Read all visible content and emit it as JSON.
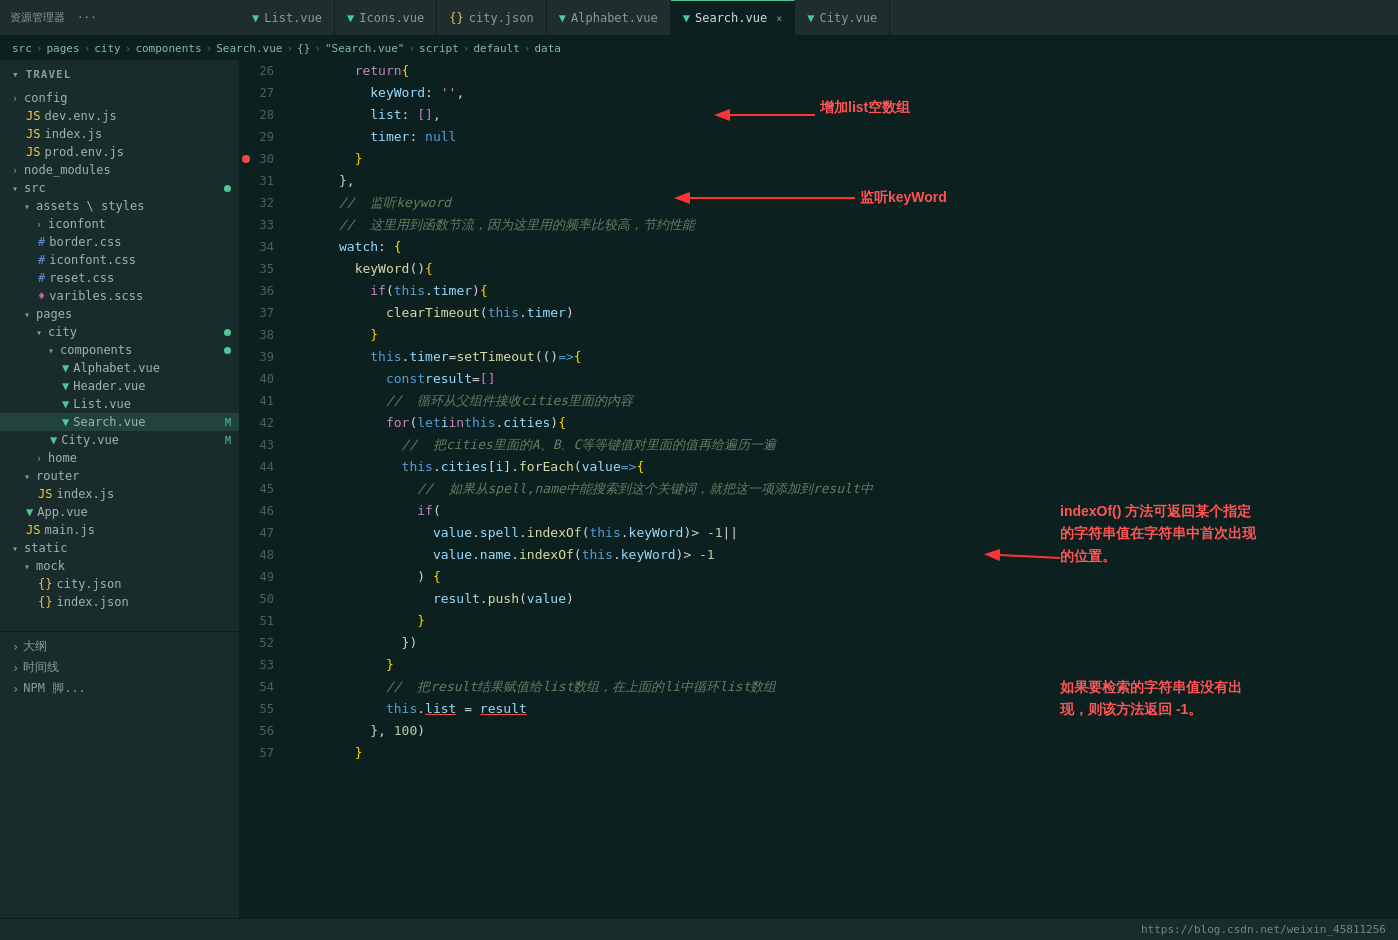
{
  "topbar": {
    "title": "资源管理器",
    "more_label": "···"
  },
  "tabs": [
    {
      "id": "list",
      "label": "List.vue",
      "type": "vue",
      "active": false,
      "modified": false
    },
    {
      "id": "icons",
      "label": "Icons.vue",
      "type": "vue",
      "active": false,
      "modified": false
    },
    {
      "id": "city-json",
      "label": "city.json",
      "type": "json",
      "active": false,
      "modified": false
    },
    {
      "id": "alphabet",
      "label": "Alphabet.vue",
      "type": "vue",
      "active": false,
      "modified": false
    },
    {
      "id": "search",
      "label": "Search.vue",
      "type": "vue",
      "active": true,
      "modified": false,
      "closable": true
    },
    {
      "id": "city-vue",
      "label": "City.vue",
      "type": "vue",
      "active": false,
      "modified": false
    }
  ],
  "breadcrumb": {
    "parts": [
      "src",
      "pages",
      "city",
      "components",
      "Search.vue",
      "{}",
      "\"Search.vue\"",
      "script",
      "default",
      "data"
    ]
  },
  "sidebar": {
    "root_label": "TRAVEL",
    "items": [
      {
        "id": "config",
        "label": "config",
        "type": "folder",
        "level": 1,
        "collapsed": true
      },
      {
        "id": "dev-env",
        "label": "dev.env.js",
        "type": "js",
        "level": 2
      },
      {
        "id": "index-js-config",
        "label": "index.js",
        "type": "js",
        "level": 2
      },
      {
        "id": "prod-env",
        "label": "prod.env.js",
        "type": "js",
        "level": 2
      },
      {
        "id": "node-modules",
        "label": "node_modules",
        "type": "folder",
        "level": 1,
        "collapsed": true
      },
      {
        "id": "src",
        "label": "src",
        "type": "folder",
        "level": 1,
        "expanded": true,
        "dot": true
      },
      {
        "id": "assets-styles",
        "label": "assets \\ styles",
        "type": "folder",
        "level": 2,
        "expanded": true
      },
      {
        "id": "iconfont",
        "label": "iconfont",
        "type": "folder",
        "level": 3,
        "collapsed": true
      },
      {
        "id": "border-css",
        "label": "border.css",
        "type": "css",
        "level": 3
      },
      {
        "id": "iconfont-css",
        "label": "iconfont.css",
        "type": "css",
        "level": 3
      },
      {
        "id": "reset-css",
        "label": "reset.css",
        "type": "css",
        "level": 3
      },
      {
        "id": "varibles-scss",
        "label": "varibles.scss",
        "type": "scss",
        "level": 3
      },
      {
        "id": "pages",
        "label": "pages",
        "type": "folder",
        "level": 2,
        "expanded": true
      },
      {
        "id": "city-folder",
        "label": "city",
        "type": "folder",
        "level": 3,
        "expanded": true,
        "dot": true
      },
      {
        "id": "components",
        "label": "components",
        "type": "folder",
        "level": 4,
        "expanded": true,
        "dot": true
      },
      {
        "id": "alphabet-vue",
        "label": "Alphabet.vue",
        "type": "vue",
        "level": 5
      },
      {
        "id": "header-vue",
        "label": "Header.vue",
        "type": "vue",
        "level": 5
      },
      {
        "id": "list-vue",
        "label": "List.vue",
        "type": "vue",
        "level": 5
      },
      {
        "id": "search-vue",
        "label": "Search.vue",
        "type": "vue",
        "level": 5,
        "badge": "M",
        "selected": true
      },
      {
        "id": "city-vue-file",
        "label": "City.vue",
        "type": "vue",
        "level": 4,
        "badge": "M"
      },
      {
        "id": "home",
        "label": "home",
        "type": "folder",
        "level": 3,
        "collapsed": true
      },
      {
        "id": "router",
        "label": "router",
        "type": "folder",
        "level": 2,
        "expanded": true
      },
      {
        "id": "router-index",
        "label": "index.js",
        "type": "js",
        "level": 3
      },
      {
        "id": "app-vue",
        "label": "App.vue",
        "type": "vue",
        "level": 2
      },
      {
        "id": "main-js",
        "label": "main.js",
        "type": "js",
        "level": 2
      },
      {
        "id": "static",
        "label": "static",
        "type": "folder",
        "level": 1,
        "expanded": true
      },
      {
        "id": "mock",
        "label": "mock",
        "type": "folder",
        "level": 2,
        "expanded": true
      },
      {
        "id": "city-json-file",
        "label": "city.json",
        "type": "json",
        "level": 3
      },
      {
        "id": "index-json",
        "label": "index.json",
        "type": "json",
        "level": 3
      }
    ]
  },
  "bottom_sidebar": [
    {
      "label": "大纲"
    },
    {
      "label": "时间线"
    },
    {
      "label": "NPM 脚..."
    }
  ],
  "code": {
    "lines": [
      {
        "num": 26,
        "content": "        return {"
      },
      {
        "num": 27,
        "content": "          keyWord: '',"
      },
      {
        "num": 28,
        "content": "          list: [],"
      },
      {
        "num": 29,
        "content": "          timer: null"
      },
      {
        "num": 30,
        "content": "        }",
        "red_dot": true
      },
      {
        "num": 31,
        "content": "      },"
      },
      {
        "num": 32,
        "content": "      //  监听keyword"
      },
      {
        "num": 33,
        "content": "      //  这里用到函数节流，因为这里用的频率比较高，节约性能"
      },
      {
        "num": 34,
        "content": "      watch: {"
      },
      {
        "num": 35,
        "content": "        keyWord() {"
      },
      {
        "num": 36,
        "content": "          if (this.timer) {"
      },
      {
        "num": 37,
        "content": "            clearTimeout(this.timer)"
      },
      {
        "num": 38,
        "content": "          }"
      },
      {
        "num": 39,
        "content": "          this.timer = setTimeout(() => {"
      },
      {
        "num": 40,
        "content": "            const result = []"
      },
      {
        "num": 41,
        "content": "            //  循环从父组件接收cities里面的内容"
      },
      {
        "num": 42,
        "content": "            for (let i in this.cities) {"
      },
      {
        "num": 43,
        "content": "              //  把cities里面的A、B、C等等键值对里面的值再给遍历一遍"
      },
      {
        "num": 44,
        "content": "              this.cities[i].forEach(value => {"
      },
      {
        "num": 45,
        "content": "                //  如果从spell,name中能搜索到这个关键词，就把这一项添加到result中"
      },
      {
        "num": 46,
        "content": "                if ("
      },
      {
        "num": 47,
        "content": "                  value.spell.indexOf(this.keyWord) > -1 ||"
      },
      {
        "num": 48,
        "content": "                  value.name.indexOf(this.keyWord) > -1"
      },
      {
        "num": 49,
        "content": "                ) {"
      },
      {
        "num": 50,
        "content": "                  result.push(value)"
      },
      {
        "num": 51,
        "content": "                }"
      },
      {
        "num": 52,
        "content": "              })"
      },
      {
        "num": 53,
        "content": "            }"
      },
      {
        "num": 54,
        "content": "            //  把result结果赋值给list数组，在上面的li中循环list数组"
      },
      {
        "num": 55,
        "content": "            this.list = result"
      },
      {
        "num": 56,
        "content": "          }, 100)"
      },
      {
        "num": 57,
        "content": "        }"
      }
    ]
  },
  "annotations": {
    "ann1": "增加list空数组",
    "ann2": "监听keyWord",
    "ann3_title": "indexOf() 方法可返回某个指定",
    "ann3_line2": "的字符串值在字符串中首次出现",
    "ann3_line3": "的位置。",
    "ann4_title": "如果要检索的字符串值没有出",
    "ann4_line2": "现，则该方法返回 -1。"
  },
  "status_bar": {
    "left": [
      "大纲",
      "时间线",
      "NPM 脚..."
    ],
    "right": "https://blog.csdn.net/weixin_45811256"
  }
}
